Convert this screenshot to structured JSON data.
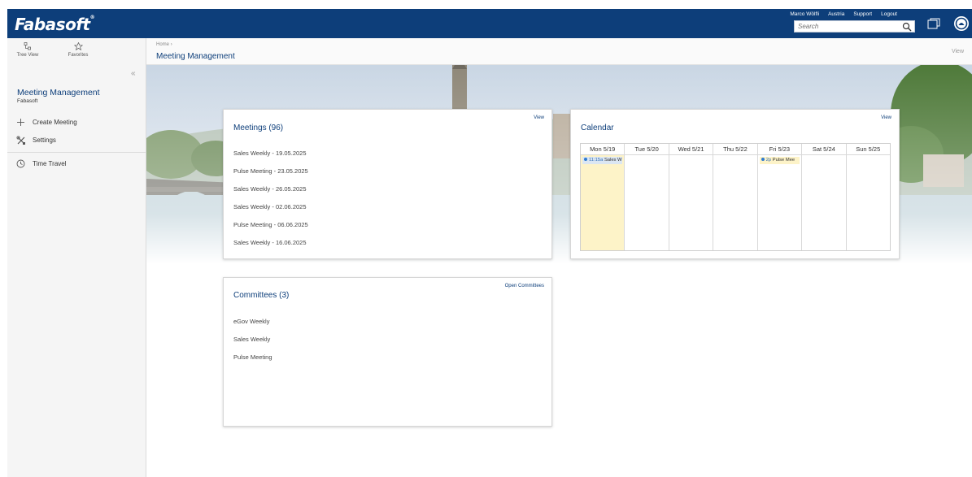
{
  "header": {
    "logo_text": "Fabasoft",
    "logo_mark": "®",
    "links": [
      "Marco Wölfli",
      "Austria",
      "Support",
      "Logout"
    ],
    "search_placeholder": "Search",
    "bar_color": "#0d3e7a"
  },
  "toolbar": {
    "tree_view_label": "Tree View",
    "favorites_label": "Favorites",
    "collapse_glyph": "«"
  },
  "sidebar": {
    "title": "Meeting Management",
    "subtitle": "Fabasoft",
    "items": [
      {
        "label": "Create Meeting",
        "icon": "plus-icon"
      },
      {
        "label": "Settings",
        "icon": "tools-icon"
      },
      {
        "label": "Time Travel",
        "icon": "clock-icon"
      }
    ]
  },
  "breadcrumb": {
    "home": "Home",
    "separator": "›",
    "title": "Meeting Management",
    "view_label": "View"
  },
  "meetings": {
    "title": "Meetings (96)",
    "view_label": "View",
    "items": [
      "Sales Weekly - 19.05.2025",
      "Pulse Meeting - 23.05.2025",
      "Sales Weekly - 26.05.2025",
      "Sales Weekly - 02.06.2025",
      "Pulse Meeting - 06.06.2025",
      "Sales Weekly - 16.06.2025"
    ]
  },
  "calendar": {
    "title": "Calendar",
    "view_label": "View",
    "days": [
      "Mon 5/19",
      "Tue 5/20",
      "Wed 5/21",
      "Thu 5/22",
      "Fri 5/23",
      "Sat 5/24",
      "Sun 5/25"
    ],
    "events": {
      "mon": {
        "time": "11:15a",
        "title": "Sales W"
      },
      "fri": {
        "time": "2p",
        "title": "Pulse Mee"
      }
    }
  },
  "committees": {
    "title": "Committees (3)",
    "link_label": "Open Committees",
    "items": [
      "eGov Weekly",
      "Sales Weekly",
      "Pulse Meeting"
    ]
  }
}
